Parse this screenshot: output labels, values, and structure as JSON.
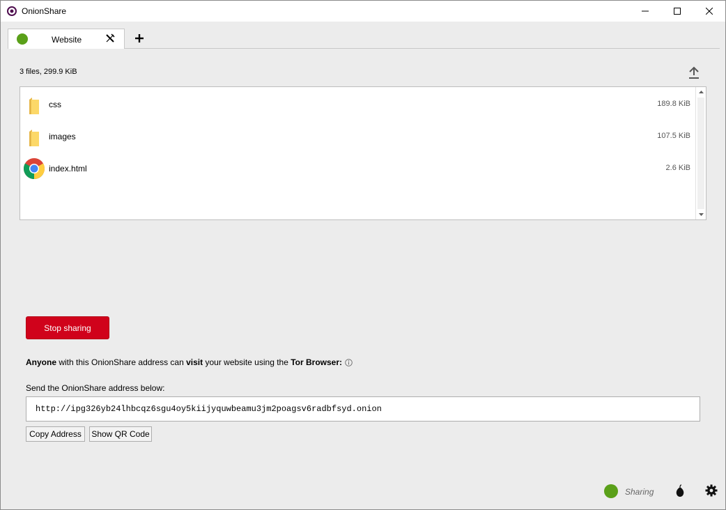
{
  "window": {
    "title": "OnionShare",
    "icons": {
      "logo": "onionshare-logo-icon",
      "minimize": "minimize-icon",
      "maximize": "maximize-icon",
      "close": "close-icon"
    }
  },
  "tabs": [
    {
      "label": "Website",
      "status_color": "#5aa019",
      "active": true
    }
  ],
  "files_summary": "3 files, 299.9 KiB",
  "files": [
    {
      "name": "css",
      "size": "189.8 KiB",
      "icon": "folder-icon"
    },
    {
      "name": "images",
      "size": "107.5 KiB",
      "icon": "folder-icon"
    },
    {
      "name": "index.html",
      "size": "2.6 KiB",
      "icon": "chrome-icon"
    }
  ],
  "stop_button": "Stop sharing",
  "info": {
    "part1_bold": "Anyone",
    "part2": " with this OnionShare address can ",
    "part3_bold": "visit",
    "part4": " your website using the ",
    "part5_bold": "Tor Browser:"
  },
  "send_label": "Send the OnionShare address below:",
  "address": "http://ipg326yb24lhbcqz6sgu4oy5kiijyquwbeamu3jm2poagsv6radbfsyd.onion",
  "buttons": {
    "copy": "Copy Address",
    "qr": "Show QR Code"
  },
  "status": {
    "text": "Sharing",
    "color": "#5aa019"
  },
  "colors": {
    "accent_red": "#d0021b",
    "status_green": "#5aa019"
  }
}
